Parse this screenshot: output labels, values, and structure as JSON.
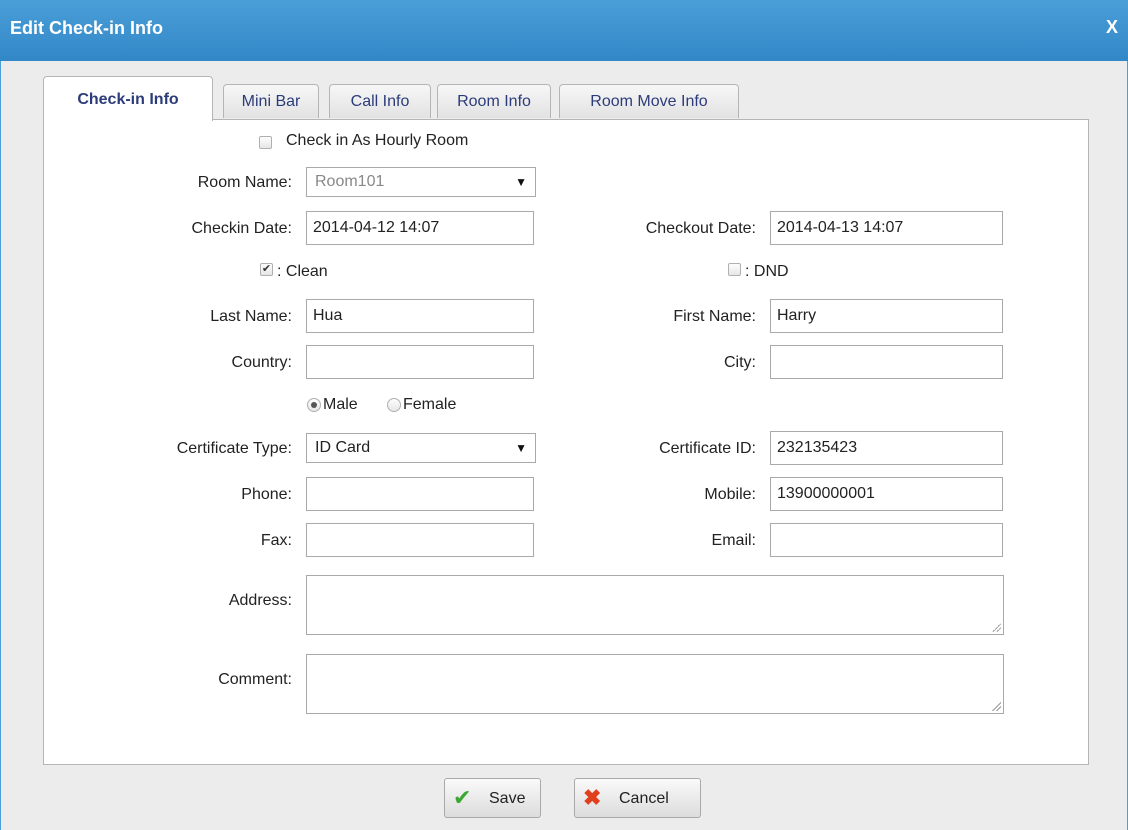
{
  "dialog": {
    "title": "Edit Check-in Info",
    "close_label": "X"
  },
  "tabs": [
    {
      "label": "Check-in Info",
      "active": true
    },
    {
      "label": "Mini Bar"
    },
    {
      "label": "Call Info"
    },
    {
      "label": "Room Info"
    },
    {
      "label": "Room Move Info"
    }
  ],
  "form": {
    "hourly_label": "Check in As Hourly Room",
    "hourly_checked": false,
    "room_name_label": "Room Name:",
    "room_name_value": "Room101",
    "checkin_date_label": "Checkin Date:",
    "checkin_date_value": "2014-04-12 14:07",
    "checkout_date_label": "Checkout Date:",
    "checkout_date_value": "2014-04-13 14:07",
    "clean_label": ":  Clean",
    "clean_checked": true,
    "dnd_label": ":  DND",
    "dnd_checked": false,
    "last_name_label": "Last Name:",
    "last_name_value": "Hua",
    "first_name_label": "First Name:",
    "first_name_value": "Harry",
    "country_label": "Country:",
    "country_value": "",
    "city_label": "City:",
    "city_value": "",
    "male_label": "Male",
    "female_label": "Female",
    "gender_selected": "Male",
    "certificate_type_label": "Certificate Type:",
    "certificate_type_value": "ID Card",
    "certificate_id_label": "Certificate ID:",
    "certificate_id_value": "232135423",
    "phone_label": "Phone:",
    "phone_value": "",
    "mobile_label": "Mobile:",
    "mobile_value": "13900000001",
    "fax_label": "Fax:",
    "fax_value": "",
    "email_label": "Email:",
    "email_value": "",
    "address_label": "Address:",
    "comment_label": "Comment:"
  },
  "buttons": {
    "save_label": "Save",
    "cancel_label": "Cancel"
  },
  "colors": {
    "titlebar": "#3c93d0",
    "tab_text": "#2c3c7a",
    "save_icon": "#3aa832",
    "cancel_icon": "#e0401c"
  }
}
